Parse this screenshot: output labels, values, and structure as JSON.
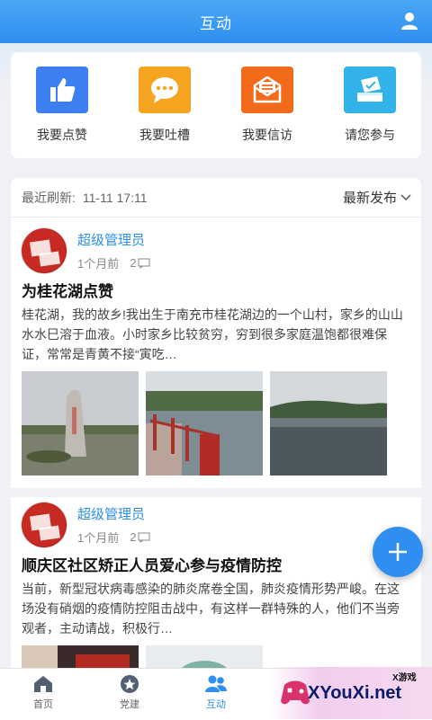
{
  "header": {
    "title": "互动"
  },
  "actions": [
    {
      "label": "我要点赞",
      "icon": "thumbs-up-icon",
      "color": "#3b7ff0"
    },
    {
      "label": "我要吐槽",
      "icon": "chat-bubble-icon",
      "color": "#f6a41f"
    },
    {
      "label": "我要信访",
      "icon": "mail-envelope-icon",
      "color": "#f36a1b"
    },
    {
      "label": "请您参与",
      "icon": "ballot-box-icon",
      "color": "#31b3ea"
    }
  ],
  "feed": {
    "refresh_label": "最近刷新:",
    "refresh_time": "11-11 17:11",
    "sort_label": "最新发布"
  },
  "posts": [
    {
      "author": "超级管理员",
      "time": "1个月前",
      "comments": "2",
      "title": "为桂花湖点赞",
      "body": "桂花湖，我的故乡!我出生于南充市桂花湖边的一个山村，家乡的山山水水巳溶于血液。小时家乡比较贫穷，穷到很多家庭温饱都很难保证，常常是青黄不接“寅吃…"
    },
    {
      "author": "超级管理员",
      "time": "1个月前",
      "comments": "2",
      "title": "顺庆区社区矫正人员爱心参与疫情防控",
      "body": "当前，新型冠状病毒感染的肺炎席卷全国，肺炎疫情形势严峻。在这场没有硝烟的疫情防控阻击战中，有这样一群特殊的人，他们不当旁观者，主动请战，积极行…"
    }
  ],
  "tabs": [
    {
      "label": "首页",
      "icon": "home-icon"
    },
    {
      "label": "党建",
      "icon": "party-star-icon"
    },
    {
      "label": "互动",
      "icon": "people-icon",
      "active": true
    },
    {
      "label": "",
      "icon": ""
    },
    {
      "label": "",
      "icon": ""
    }
  ],
  "watermark": {
    "small": "X游戏",
    "big": "XYouXi.net"
  },
  "colors": {
    "primary": "#2f8ff0",
    "author": "#2d8ee8"
  }
}
